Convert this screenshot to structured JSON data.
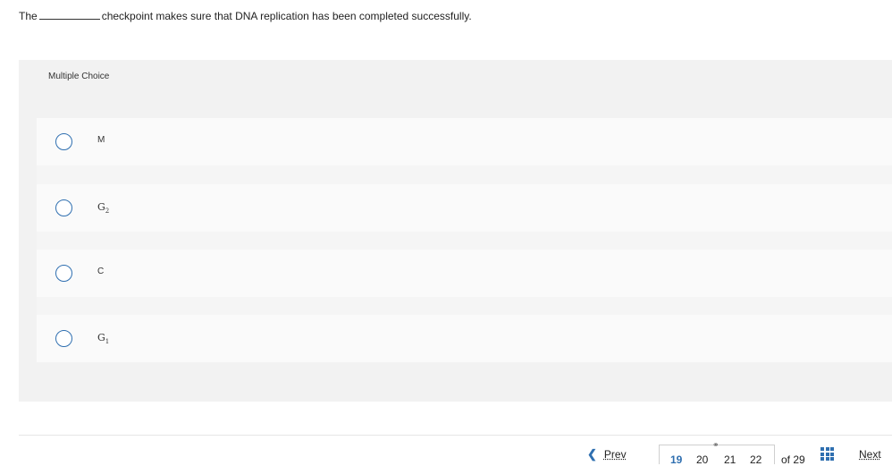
{
  "question": {
    "prefix": "The",
    "suffix": "checkpoint makes sure that DNA replication has been completed successfully."
  },
  "panel": {
    "label": "Multiple Choice"
  },
  "choices": [
    {
      "main": "M",
      "sub": ""
    },
    {
      "main": "G",
      "sub": "2"
    },
    {
      "main": "C",
      "sub": ""
    },
    {
      "main": "G",
      "sub": "1"
    }
  ],
  "nav": {
    "prev_label": "Prev",
    "pages": [
      "19",
      "20",
      "21",
      "22"
    ],
    "current_page": "19",
    "of_label": "of 29",
    "next_label": "Next"
  },
  "colors": {
    "accent": "#2f6fb0",
    "panel_bg": "#f2f2f2",
    "choice_bg": "#fafafa"
  }
}
